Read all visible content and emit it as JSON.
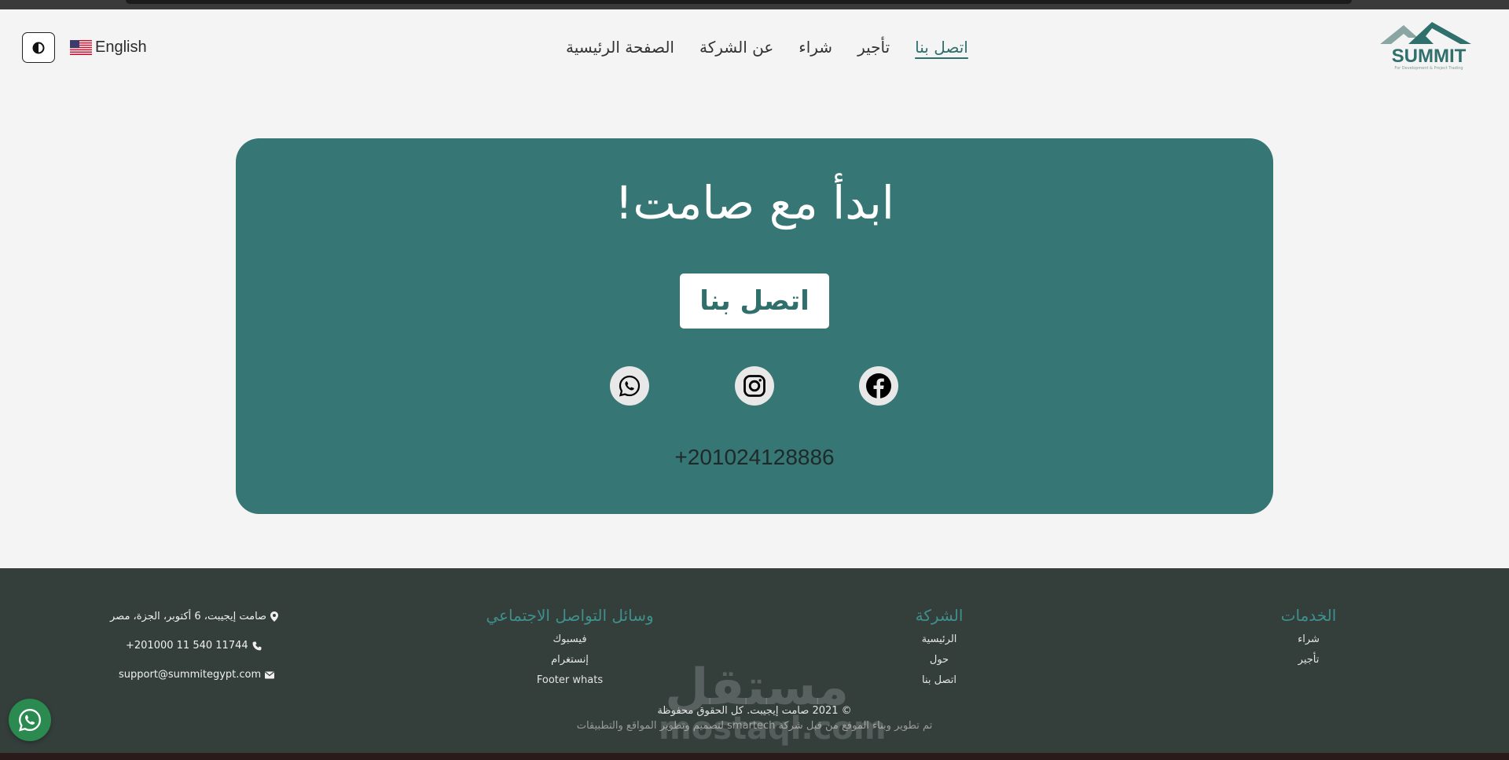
{
  "header": {
    "language_label": "English",
    "nav": [
      {
        "label": "الصفحة الرئيسية",
        "active": false
      },
      {
        "label": "عن الشركة",
        "active": false
      },
      {
        "label": "شراء",
        "active": false
      },
      {
        "label": "تأجير",
        "active": false
      },
      {
        "label": "اتصل بنا",
        "active": true
      }
    ],
    "logo_text": "SUMMIT",
    "logo_tagline": "For Development & Project Trading",
    "icons": {
      "theme": "contrast-toggle-icon",
      "flag": "us-flag-icon"
    }
  },
  "hero": {
    "title": "ابدأ مع صامت!",
    "cta_label": "اتصل بنا",
    "phone": "+201024128886",
    "social_icons": [
      "facebook-icon",
      "instagram-icon",
      "whatsapp-icon"
    ]
  },
  "footer": {
    "services": {
      "title": "الخدمات",
      "links": [
        "شراء",
        "تأجير"
      ]
    },
    "company": {
      "title": "الشركة",
      "links": [
        "الرئيسية",
        "حول",
        "اتصل بنا"
      ]
    },
    "social": {
      "title": "وسائل التواصل الاجتماعي",
      "links": [
        "فيسبوك",
        "إنستغرام",
        "Footer whats"
      ]
    },
    "contact": {
      "address": "صامت إيجيبت، 6 أكتوبر، الجزة، مصر",
      "phone": "+201000 11 540 11744",
      "email": "support@summitegypt.com"
    },
    "copyright": "© 2021 صامت إيجيبت. كل الحقوق محفوظة",
    "credit": "تم تطوير وبناء الموقع من قبل شركة smartech لتصميم وتطوير المواقع والتطبيقات"
  },
  "watermark": {
    "arabic": "مستقل",
    "latin": "mostaql.com"
  },
  "colors": {
    "accent": "#367674",
    "footer_bg": "#343f3c",
    "footer_heading": "#3f8f8b",
    "page_bg": "#f4f4f4"
  }
}
